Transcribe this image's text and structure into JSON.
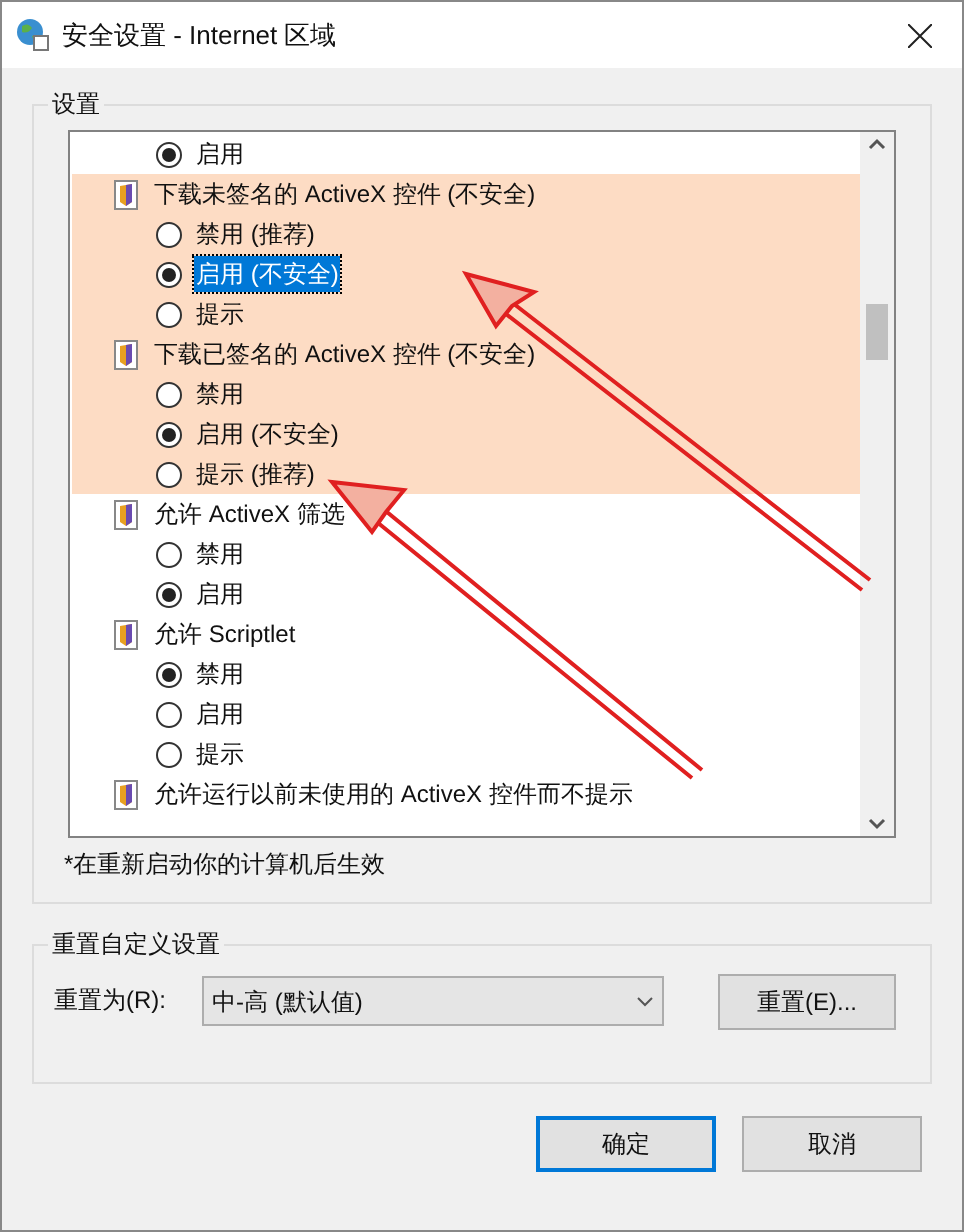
{
  "window": {
    "title": "安全设置 - Internet 区域"
  },
  "settings_group": {
    "title": "设置",
    "rows": [
      {
        "kind": "option",
        "label": "启用",
        "checked": true,
        "selected": false,
        "shaded": false
      },
      {
        "kind": "setting",
        "label": "下载未签名的 ActiveX 控件 (不安全)",
        "shaded": true
      },
      {
        "kind": "option",
        "label": "禁用 (推荐)",
        "checked": false,
        "selected": false,
        "shaded": true
      },
      {
        "kind": "option",
        "label": "启用 (不安全)",
        "checked": true,
        "selected": true,
        "shaded": true
      },
      {
        "kind": "option",
        "label": "提示",
        "checked": false,
        "selected": false,
        "shaded": true
      },
      {
        "kind": "setting",
        "label": "下载已签名的 ActiveX 控件 (不安全)",
        "shaded": true
      },
      {
        "kind": "option",
        "label": "禁用",
        "checked": false,
        "selected": false,
        "shaded": true
      },
      {
        "kind": "option",
        "label": "启用 (不安全)",
        "checked": true,
        "selected": false,
        "shaded": true
      },
      {
        "kind": "option",
        "label": "提示 (推荐)",
        "checked": false,
        "selected": false,
        "shaded": true
      },
      {
        "kind": "setting",
        "label": "允许 ActiveX 筛选",
        "shaded": false
      },
      {
        "kind": "option",
        "label": "禁用",
        "checked": false,
        "selected": false,
        "shaded": false
      },
      {
        "kind": "option",
        "label": "启用",
        "checked": true,
        "selected": false,
        "shaded": false
      },
      {
        "kind": "setting",
        "label": "允许 Scriptlet",
        "shaded": false
      },
      {
        "kind": "option",
        "label": "禁用",
        "checked": true,
        "selected": false,
        "shaded": false
      },
      {
        "kind": "option",
        "label": "启用",
        "checked": false,
        "selected": false,
        "shaded": false
      },
      {
        "kind": "option",
        "label": "提示",
        "checked": false,
        "selected": false,
        "shaded": false
      },
      {
        "kind": "setting",
        "label": "允许运行以前未使用的 ActiveX 控件而不提示",
        "shaded": false
      }
    ],
    "note": "*在重新启动你的计算机后生效"
  },
  "reset_group": {
    "title": "重置自定义设置",
    "label": "重置为(R):",
    "dropdown_value": "中-高 (默认值)",
    "button": "重置(E)..."
  },
  "buttons": [
    {
      "label": "确定",
      "default": true
    },
    {
      "label": "取消",
      "default": false
    }
  ]
}
